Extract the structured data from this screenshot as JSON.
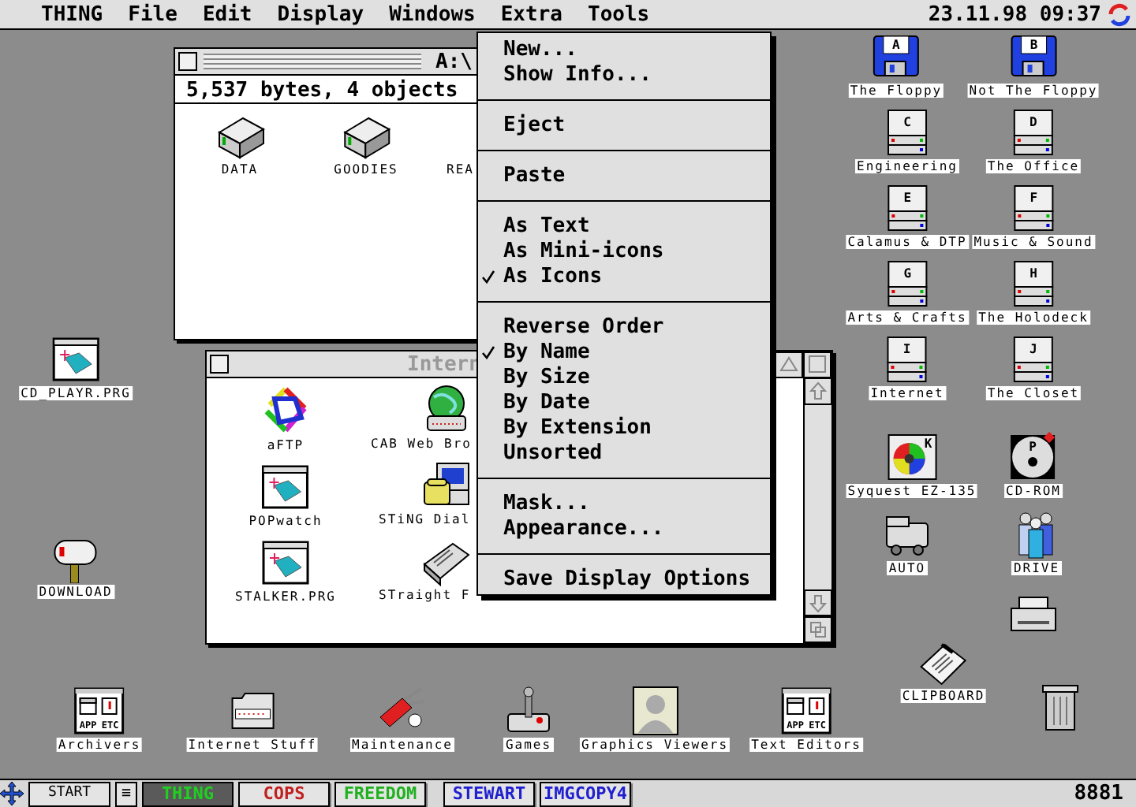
{
  "menu_bar": {
    "items": [
      {
        "label": "THING"
      },
      {
        "label": "File"
      },
      {
        "label": "Edit"
      },
      {
        "label": "Display"
      },
      {
        "label": "Windows"
      },
      {
        "label": "Extra"
      },
      {
        "label": "Tools"
      }
    ],
    "clock": "23.11.98 09:37"
  },
  "windows": [
    {
      "title": "A:\\",
      "active": true,
      "info": "5,537 bytes, 4 objects",
      "icons": [
        {
          "kind": "drive-box",
          "label": "DATA"
        },
        {
          "kind": "drive-box",
          "label": "GOODIES"
        },
        {
          "label": "REA"
        }
      ]
    },
    {
      "title": "Intern",
      "active": false,
      "icons": [
        {
          "kind": "arrows",
          "label": "aFTP"
        },
        {
          "kind": "globe",
          "label": "CAB Web Bro"
        },
        {
          "kind": "program",
          "label": "POPwatch"
        },
        {
          "kind": "phone",
          "label": "STiNG Dial"
        },
        {
          "kind": "program",
          "label": "STALKER.PRG"
        },
        {
          "kind": "fax",
          "label": "STraight F"
        }
      ]
    }
  ],
  "open_menu": {
    "groups": [
      [
        {
          "label": "New...",
          "checked": false
        },
        {
          "label": "Show Info...",
          "checked": false
        }
      ],
      [
        {
          "label": "Eject",
          "checked": false
        }
      ],
      [
        {
          "label": "Paste",
          "checked": false
        }
      ],
      [
        {
          "label": "As Text",
          "checked": false
        },
        {
          "label": "As Mini-icons",
          "checked": false
        },
        {
          "label": "As Icons",
          "checked": true
        }
      ],
      [
        {
          "label": "Reverse Order",
          "checked": false
        },
        {
          "label": "By Name",
          "checked": true
        },
        {
          "label": "By Size",
          "checked": false
        },
        {
          "label": "By Date",
          "checked": false
        },
        {
          "label": "By Extension",
          "checked": false
        },
        {
          "label": "Unsorted",
          "checked": false
        }
      ],
      [
        {
          "label": "Mask...",
          "checked": false
        },
        {
          "label": "Appearance...",
          "checked": false
        }
      ],
      [
        {
          "label": "Save Display Options",
          "checked": false
        }
      ]
    ]
  },
  "desktop_icons": [
    {
      "kind": "floppy",
      "letter": "A",
      "label": "The Floppy"
    },
    {
      "kind": "floppy",
      "letter": "B",
      "label": "Not The Floppy"
    },
    {
      "kind": "harddisk",
      "letter": "C",
      "label": "Engineering"
    },
    {
      "kind": "harddisk",
      "letter": "D",
      "label": "The Office"
    },
    {
      "kind": "harddisk",
      "letter": "E",
      "label": "Calamus & DTP"
    },
    {
      "kind": "harddisk",
      "letter": "F",
      "label": "Music & Sound"
    },
    {
      "kind": "harddisk",
      "letter": "G",
      "label": "Arts & Crafts"
    },
    {
      "kind": "harddisk",
      "letter": "H",
      "label": "The Holodeck"
    },
    {
      "kind": "program",
      "label": "CD_PLAYR.PRG"
    },
    {
      "kind": "harddisk",
      "letter": "I",
      "label": "Internet"
    },
    {
      "kind": "harddisk",
      "letter": "J",
      "label": "The Closet"
    },
    {
      "kind": "syquest",
      "letter": "K",
      "label": "Syquest EZ-135"
    },
    {
      "kind": "cdrom",
      "letter": "P",
      "label": "CD-ROM"
    },
    {
      "kind": "van",
      "label": "AUTO"
    },
    {
      "kind": "people",
      "label": "DRIVE"
    },
    {
      "kind": "mailbox",
      "label": "DOWNLOAD"
    },
    {
      "kind": "printer"
    },
    {
      "kind": "clipboard",
      "label": "CLIPBOARD"
    },
    {
      "kind": "appetc",
      "captions": [
        "APP",
        "ETC"
      ],
      "label": "Archivers"
    },
    {
      "kind": "netbox",
      "label": "Internet Stuff"
    },
    {
      "kind": "knife",
      "label": "Maintenance"
    },
    {
      "kind": "joystick",
      "label": "Games"
    },
    {
      "kind": "portrait",
      "label": "Graphics Viewers"
    },
    {
      "kind": "appetc",
      "captions": [
        "APP",
        "ETC"
      ],
      "label": "Text Editors"
    },
    {
      "kind": "trash"
    }
  ],
  "taskbar": {
    "start": "START",
    "menu_glyph": "≡",
    "tasks": [
      {
        "label": "THING",
        "color": "#20d020",
        "selected": true
      },
      {
        "label": "COPS",
        "color": "#c02020",
        "selected": false
      },
      {
        "label": "FREEDOM",
        "color": "#20b020",
        "selected": false
      },
      {
        "label": "STEWART",
        "color": "#2020d0",
        "selected": false
      },
      {
        "label": "IMGCOPY4",
        "color": "#2020d0",
        "selected": false
      }
    ],
    "counter": "8881"
  }
}
